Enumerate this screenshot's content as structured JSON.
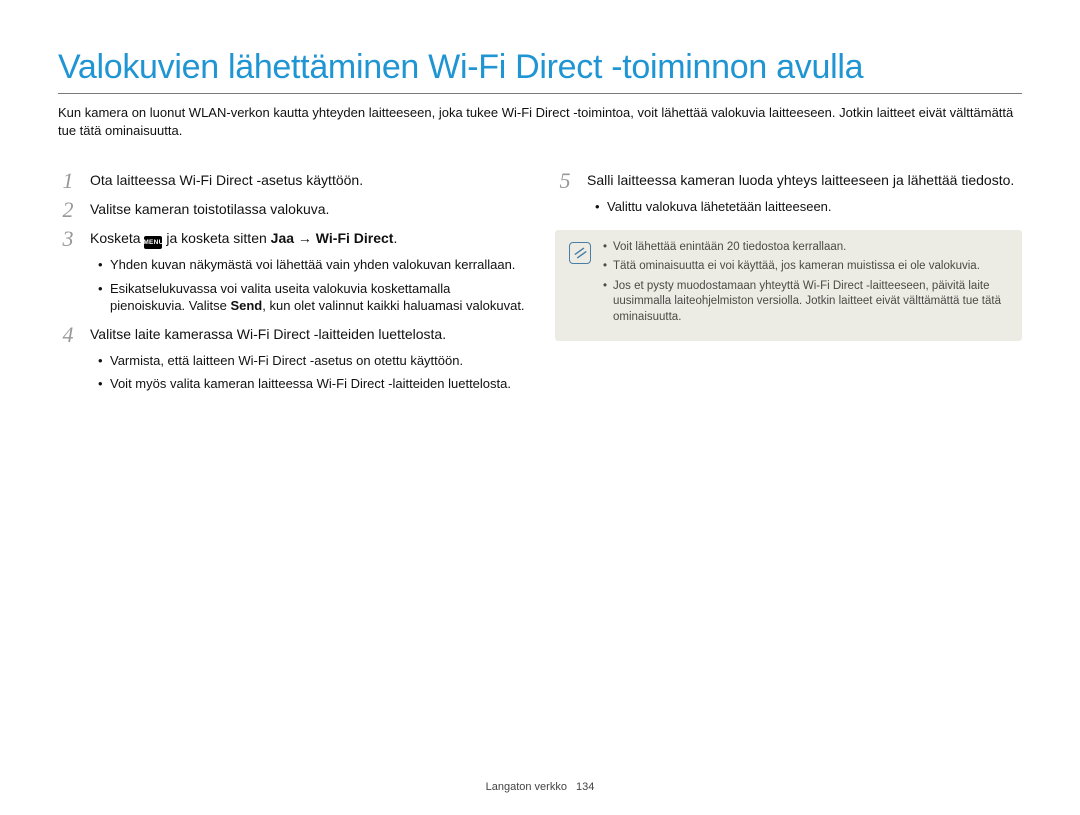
{
  "title": "Valokuvien lähettäminen Wi-Fi Direct -toiminnon avulla",
  "intro": "Kun kamera on luonut WLAN-verkon kautta yhteyden laitteeseen, joka tukee Wi-Fi Direct -toimintoa, voit lähettää valokuvia laitteeseen. Jotkin laitteet eivät välttämättä tue tätä ominaisuutta.",
  "left": {
    "step1": {
      "num": "1",
      "text": "Ota laitteessa Wi-Fi Direct -asetus käyttöön."
    },
    "step2": {
      "num": "2",
      "text": "Valitse kameran toistotilassa valokuva."
    },
    "step3": {
      "num": "3",
      "pre": "Kosketa ",
      "menu": "MENU",
      "mid": " ja kosketa sitten ",
      "bold1": "Jaa",
      "arrow": " → ",
      "bold2": "Wi-Fi Direct",
      "post": ".",
      "bullets": [
        "Yhden kuvan näkymästä voi lähettää vain yhden valokuvan kerrallaan.",
        "Esikatselukuvassa voi valita useita valokuvia koskettamalla pienoiskuvia. Valitse Send, kun olet valinnut kaikki haluamasi valokuvat."
      ],
      "bullets_send_word": "Send"
    },
    "step4": {
      "num": "4",
      "text": "Valitse laite kamerassa Wi-Fi Direct -laitteiden luettelosta.",
      "bullets": [
        "Varmista, että laitteen Wi-Fi Direct -asetus on otettu käyttöön.",
        "Voit myös valita kameran laitteessa Wi-Fi Direct -laitteiden luettelosta."
      ]
    }
  },
  "right": {
    "step5": {
      "num": "5",
      "text": "Salli laitteessa kameran luoda yhteys laitteeseen ja lähettää tiedosto.",
      "bullets": [
        "Valittu valokuva lähetetään laitteeseen."
      ]
    },
    "notes": [
      "Voit lähettää enintään 20 tiedostoa kerrallaan.",
      "Tätä ominaisuutta ei voi käyttää, jos kameran muistissa ei ole valokuvia.",
      "Jos et pysty muodostamaan yhteyttä Wi-Fi Direct -laitteeseen, päivitä laite uusimmalla laiteohjelmiston versiolla. Jotkin laitteet eivät välttämättä tue tätä ominaisuutta."
    ]
  },
  "footer": {
    "section": "Langaton verkko",
    "page": "134"
  }
}
